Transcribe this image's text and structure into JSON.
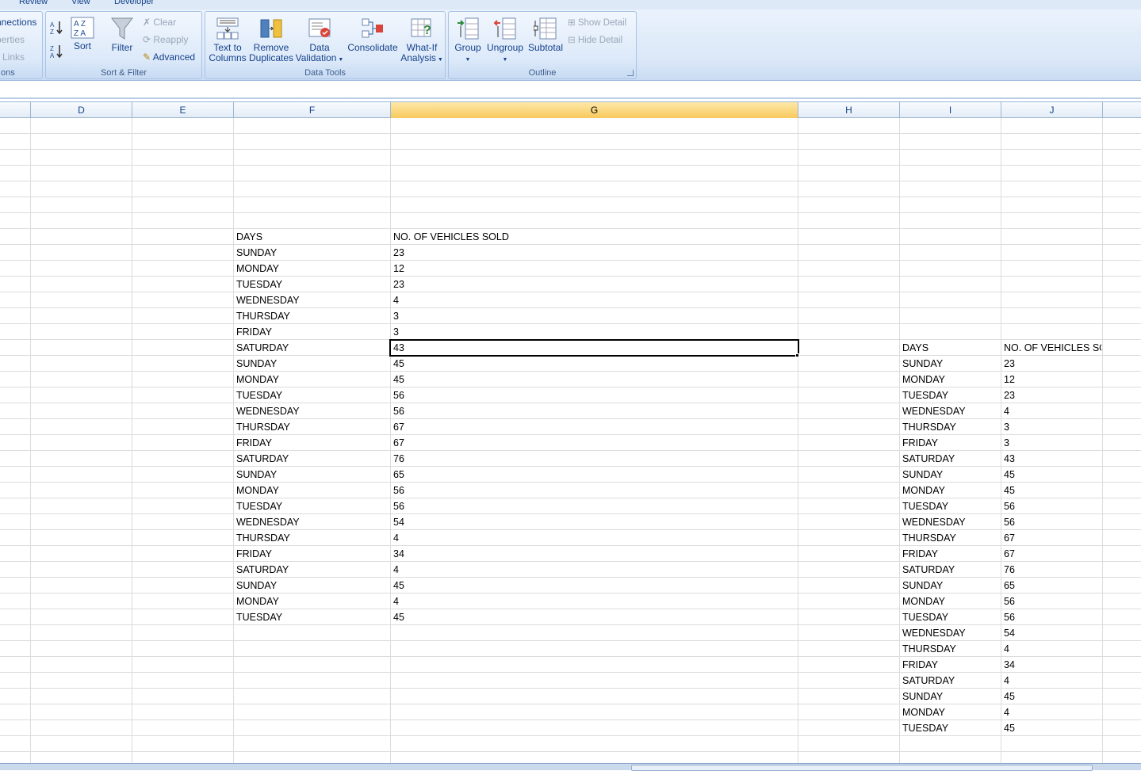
{
  "tabs": [
    "Review",
    "View",
    "Developer"
  ],
  "ribbon": {
    "connections": {
      "items": [
        "nnections",
        "perties",
        "Links"
      ],
      "label": "ons"
    },
    "sort_filter": {
      "sort": "Sort",
      "filter": "Filter",
      "clear": "Clear",
      "reapply": "Reapply",
      "advanced": "Advanced",
      "label": "Sort & Filter"
    },
    "data_tools": {
      "text_to_columns": [
        "Text to",
        "Columns"
      ],
      "remove_duplicates": [
        "Remove",
        "Duplicates"
      ],
      "data_validation": [
        "Data",
        "Validation"
      ],
      "consolidate": "Consolidate",
      "what_if": [
        "What-If",
        "Analysis"
      ],
      "label": "Data Tools"
    },
    "outline": {
      "group": "Group",
      "ungroup": "Ungroup",
      "subtotal": "Subtotal",
      "show_detail": "Show Detail",
      "hide_detail": "Hide Detail",
      "label": "Outline"
    }
  },
  "columns": [
    "D",
    "E",
    "F",
    "G",
    "H",
    "I",
    "J"
  ],
  "selected_column": "G",
  "table1": {
    "header": [
      "DAYS",
      "NO. OF VEHICLES SOLD"
    ],
    "rows": [
      [
        "SUNDAY",
        "23"
      ],
      [
        "MONDAY",
        "12"
      ],
      [
        "TUESDAY",
        "23"
      ],
      [
        "WEDNESDAY",
        "4"
      ],
      [
        "THURSDAY",
        "3"
      ],
      [
        "FRIDAY",
        "3"
      ],
      [
        "SATURDAY",
        "43"
      ],
      [
        "SUNDAY",
        "45"
      ],
      [
        "MONDAY",
        "45"
      ],
      [
        "TUESDAY",
        "56"
      ],
      [
        "WEDNESDAY",
        "56"
      ],
      [
        "THURSDAY",
        "67"
      ],
      [
        "FRIDAY",
        "67"
      ],
      [
        "SATURDAY",
        "76"
      ],
      [
        "SUNDAY",
        "65"
      ],
      [
        "MONDAY",
        "56"
      ],
      [
        "TUESDAY",
        "56"
      ],
      [
        "WEDNESDAY",
        "54"
      ],
      [
        "THURSDAY",
        "4"
      ],
      [
        "FRIDAY",
        "34"
      ],
      [
        "SATURDAY",
        "4"
      ],
      [
        "SUNDAY",
        "45"
      ],
      [
        "MONDAY",
        "4"
      ],
      [
        "TUESDAY",
        "45"
      ]
    ]
  },
  "table2": {
    "header": [
      "DAYS",
      "NO. OF VEHICLES SO"
    ],
    "rows": [
      [
        "SUNDAY",
        "23"
      ],
      [
        "MONDAY",
        "12"
      ],
      [
        "TUESDAY",
        "23"
      ],
      [
        "WEDNESDAY",
        "4"
      ],
      [
        "THURSDAY",
        "3"
      ],
      [
        "FRIDAY",
        "3"
      ],
      [
        "SATURDAY",
        "43"
      ],
      [
        "SUNDAY",
        "45"
      ],
      [
        "MONDAY",
        "45"
      ],
      [
        "TUESDAY",
        "56"
      ],
      [
        "WEDNESDAY",
        "56"
      ],
      [
        "THURSDAY",
        "67"
      ],
      [
        "FRIDAY",
        "67"
      ],
      [
        "SATURDAY",
        "76"
      ],
      [
        "SUNDAY",
        "65"
      ],
      [
        "MONDAY",
        "56"
      ],
      [
        "TUESDAY",
        "56"
      ],
      [
        "WEDNESDAY",
        "54"
      ],
      [
        "THURSDAY",
        "4"
      ],
      [
        "FRIDAY",
        "34"
      ],
      [
        "SATURDAY",
        "4"
      ],
      [
        "SUNDAY",
        "45"
      ],
      [
        "MONDAY",
        "4"
      ],
      [
        "TUESDAY",
        "45"
      ]
    ]
  }
}
